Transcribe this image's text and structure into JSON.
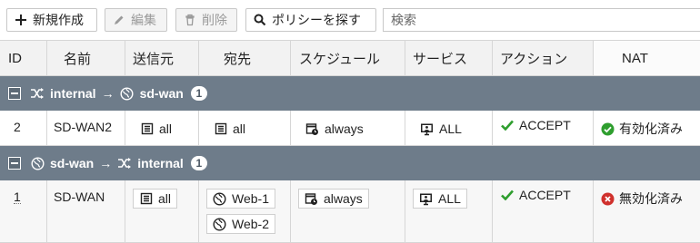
{
  "toolbar": {
    "new_label": "新規作成",
    "edit_label": "編集",
    "delete_label": "削除",
    "find_policy_label": "ポリシーを探す",
    "search_placeholder": "検索"
  },
  "columns": {
    "id": "ID",
    "name": "名前",
    "source": "送信元",
    "destination": "宛先",
    "schedule": "スケジュール",
    "service": "サービス",
    "action": "アクション",
    "nat": "NAT"
  },
  "groups": [
    {
      "from": "internal",
      "to": "sd-wan",
      "count": "1",
      "rows": [
        {
          "id": "2",
          "name": "SD-WAN2",
          "source": [
            "all"
          ],
          "destination": [
            "all"
          ],
          "schedule": "always",
          "service": "ALL",
          "action": "ACCEPT",
          "nat": "有効化済み",
          "nat_state": "enabled"
        }
      ]
    },
    {
      "from": "sd-wan",
      "to": "internal",
      "count": "1",
      "rows": [
        {
          "id": "1",
          "name": "SD-WAN",
          "source": [
            "all"
          ],
          "destination": [
            "Web-1",
            "Web-2"
          ],
          "schedule": "always",
          "service": "ALL",
          "action": "ACCEPT",
          "nat": "無効化済み",
          "nat_state": "disabled"
        }
      ]
    }
  ],
  "colors": {
    "group_bar": "#6e7c8a",
    "accept_green": "#2e9e2e",
    "disabled_red": "#d0312d",
    "enabled_green": "#2e9e2e"
  },
  "icons": {
    "new": "plus-icon",
    "edit": "pencil-icon",
    "delete": "trash-icon",
    "find": "search-icon",
    "interface_internal": "shuffle-icon",
    "interface_sdwan": "globe-icon",
    "address": "address-list-icon",
    "schedule": "calendar-clock-icon",
    "service": "monitor-icon",
    "accept": "check-icon"
  }
}
